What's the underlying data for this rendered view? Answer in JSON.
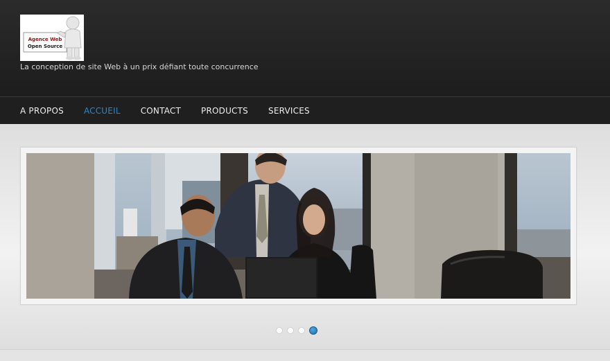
{
  "site": {
    "logo_line1": "Agence Web",
    "logo_line2": "Open Source",
    "tagline": "La conception de site Web à un prix défiant toute concurrence"
  },
  "nav": {
    "items": [
      {
        "label": "A PROPOS",
        "active": false
      },
      {
        "label": "ACCUEIL",
        "active": true
      },
      {
        "label": "CONTACT",
        "active": false
      },
      {
        "label": "PRODUCTS",
        "active": false
      },
      {
        "label": "SERVICES",
        "active": false
      }
    ]
  },
  "slider": {
    "slide_count": 4,
    "active_slide_index": 4
  },
  "colors": {
    "header_bg": "#222222",
    "nav_active": "#2f86c9",
    "nav_text": "#eeeeee",
    "dot_active": "#1f7bbd"
  }
}
